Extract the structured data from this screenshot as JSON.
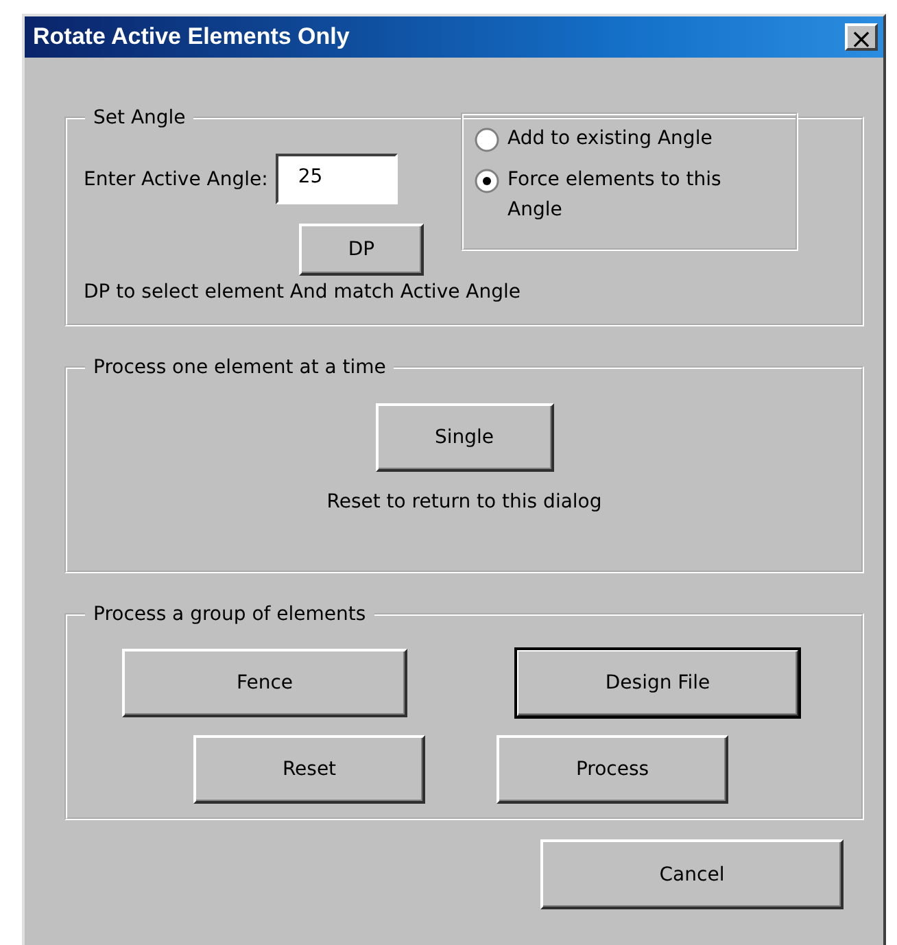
{
  "window": {
    "title": "Rotate Active Elements Only",
    "close": "×"
  },
  "set_angle": {
    "title": "Set Angle",
    "label": "Enter Active Angle:",
    "value": "25",
    "dp_button": "DP",
    "hint": "DP to select element And match Active Angle",
    "options": [
      {
        "label": "Add to existing Angle",
        "selected": false
      },
      {
        "label": "Force elements to this Angle",
        "selected": true
      }
    ]
  },
  "single": {
    "title": "Process one element at a time",
    "button": "Single",
    "note": "Reset to return to this dialog"
  },
  "group": {
    "title": "Process a group of elements",
    "buttons": [
      {
        "label": "Fence",
        "default": false
      },
      {
        "label": "Design File",
        "default": true
      },
      {
        "label": "Reset",
        "default": false
      },
      {
        "label": "Process",
        "default": false
      }
    ]
  },
  "buttons": [
    {
      "label": "Cancel",
      "default": false
    }
  ]
}
